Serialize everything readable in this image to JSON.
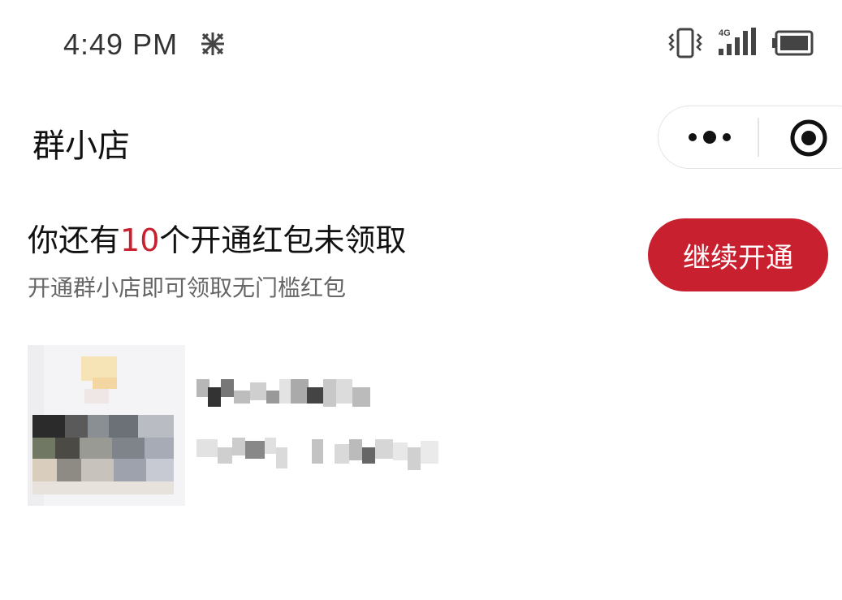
{
  "status_bar": {
    "time": "4:49 PM",
    "network_label": "4G"
  },
  "nav": {
    "title": "群小店"
  },
  "promo": {
    "title_prefix": "你还有",
    "count": "10",
    "title_suffix": "个开通红包未领取",
    "subtitle": "开通群小店即可领取无门槛红包",
    "button_label": "继续开通"
  },
  "colors": {
    "accent_red": "#c9202f",
    "count_red": "#c8202e"
  },
  "icons": [
    "carrier-icon",
    "vibrate-icon",
    "signal-icon",
    "battery-icon",
    "more-icon",
    "close-target-icon"
  ]
}
